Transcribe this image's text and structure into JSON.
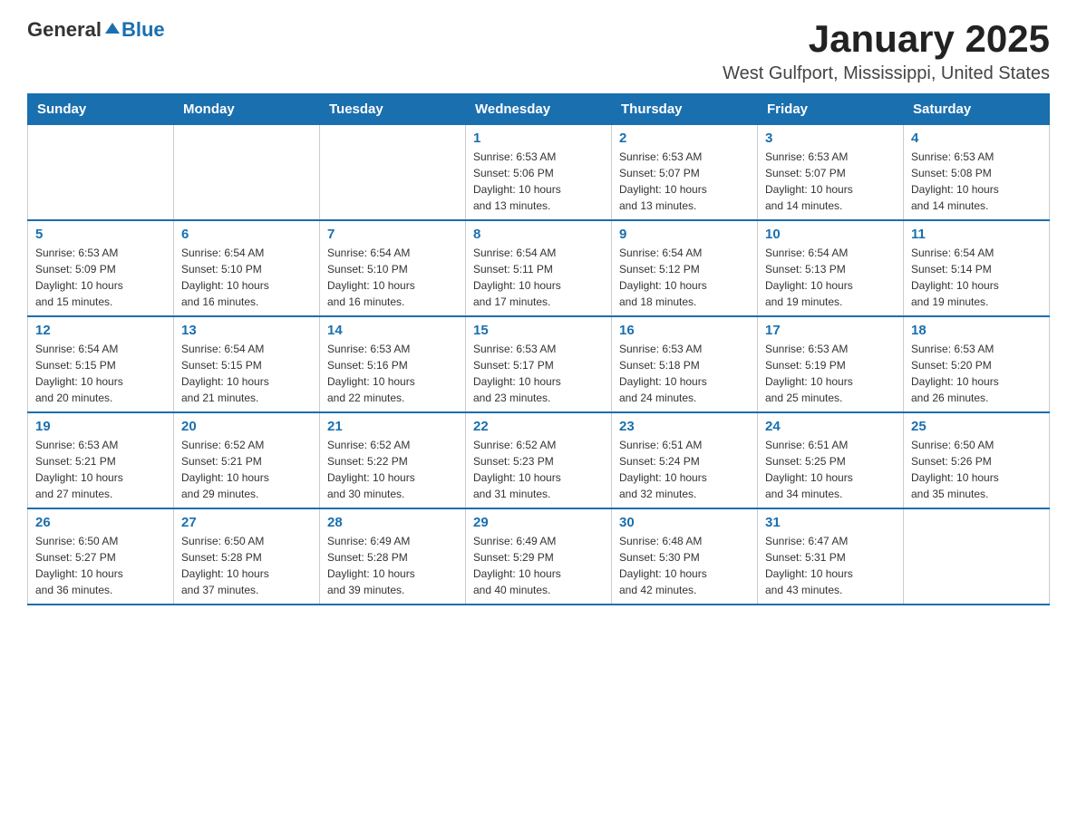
{
  "logo": {
    "general": "General",
    "blue": "Blue"
  },
  "title": "January 2025",
  "subtitle": "West Gulfport, Mississippi, United States",
  "weekdays": [
    "Sunday",
    "Monday",
    "Tuesday",
    "Wednesday",
    "Thursday",
    "Friday",
    "Saturday"
  ],
  "weeks": [
    [
      {
        "day": "",
        "info": ""
      },
      {
        "day": "",
        "info": ""
      },
      {
        "day": "",
        "info": ""
      },
      {
        "day": "1",
        "info": "Sunrise: 6:53 AM\nSunset: 5:06 PM\nDaylight: 10 hours\nand 13 minutes."
      },
      {
        "day": "2",
        "info": "Sunrise: 6:53 AM\nSunset: 5:07 PM\nDaylight: 10 hours\nand 13 minutes."
      },
      {
        "day": "3",
        "info": "Sunrise: 6:53 AM\nSunset: 5:07 PM\nDaylight: 10 hours\nand 14 minutes."
      },
      {
        "day": "4",
        "info": "Sunrise: 6:53 AM\nSunset: 5:08 PM\nDaylight: 10 hours\nand 14 minutes."
      }
    ],
    [
      {
        "day": "5",
        "info": "Sunrise: 6:53 AM\nSunset: 5:09 PM\nDaylight: 10 hours\nand 15 minutes."
      },
      {
        "day": "6",
        "info": "Sunrise: 6:54 AM\nSunset: 5:10 PM\nDaylight: 10 hours\nand 16 minutes."
      },
      {
        "day": "7",
        "info": "Sunrise: 6:54 AM\nSunset: 5:10 PM\nDaylight: 10 hours\nand 16 minutes."
      },
      {
        "day": "8",
        "info": "Sunrise: 6:54 AM\nSunset: 5:11 PM\nDaylight: 10 hours\nand 17 minutes."
      },
      {
        "day": "9",
        "info": "Sunrise: 6:54 AM\nSunset: 5:12 PM\nDaylight: 10 hours\nand 18 minutes."
      },
      {
        "day": "10",
        "info": "Sunrise: 6:54 AM\nSunset: 5:13 PM\nDaylight: 10 hours\nand 19 minutes."
      },
      {
        "day": "11",
        "info": "Sunrise: 6:54 AM\nSunset: 5:14 PM\nDaylight: 10 hours\nand 19 minutes."
      }
    ],
    [
      {
        "day": "12",
        "info": "Sunrise: 6:54 AM\nSunset: 5:15 PM\nDaylight: 10 hours\nand 20 minutes."
      },
      {
        "day": "13",
        "info": "Sunrise: 6:54 AM\nSunset: 5:15 PM\nDaylight: 10 hours\nand 21 minutes."
      },
      {
        "day": "14",
        "info": "Sunrise: 6:53 AM\nSunset: 5:16 PM\nDaylight: 10 hours\nand 22 minutes."
      },
      {
        "day": "15",
        "info": "Sunrise: 6:53 AM\nSunset: 5:17 PM\nDaylight: 10 hours\nand 23 minutes."
      },
      {
        "day": "16",
        "info": "Sunrise: 6:53 AM\nSunset: 5:18 PM\nDaylight: 10 hours\nand 24 minutes."
      },
      {
        "day": "17",
        "info": "Sunrise: 6:53 AM\nSunset: 5:19 PM\nDaylight: 10 hours\nand 25 minutes."
      },
      {
        "day": "18",
        "info": "Sunrise: 6:53 AM\nSunset: 5:20 PM\nDaylight: 10 hours\nand 26 minutes."
      }
    ],
    [
      {
        "day": "19",
        "info": "Sunrise: 6:53 AM\nSunset: 5:21 PM\nDaylight: 10 hours\nand 27 minutes."
      },
      {
        "day": "20",
        "info": "Sunrise: 6:52 AM\nSunset: 5:21 PM\nDaylight: 10 hours\nand 29 minutes."
      },
      {
        "day": "21",
        "info": "Sunrise: 6:52 AM\nSunset: 5:22 PM\nDaylight: 10 hours\nand 30 minutes."
      },
      {
        "day": "22",
        "info": "Sunrise: 6:52 AM\nSunset: 5:23 PM\nDaylight: 10 hours\nand 31 minutes."
      },
      {
        "day": "23",
        "info": "Sunrise: 6:51 AM\nSunset: 5:24 PM\nDaylight: 10 hours\nand 32 minutes."
      },
      {
        "day": "24",
        "info": "Sunrise: 6:51 AM\nSunset: 5:25 PM\nDaylight: 10 hours\nand 34 minutes."
      },
      {
        "day": "25",
        "info": "Sunrise: 6:50 AM\nSunset: 5:26 PM\nDaylight: 10 hours\nand 35 minutes."
      }
    ],
    [
      {
        "day": "26",
        "info": "Sunrise: 6:50 AM\nSunset: 5:27 PM\nDaylight: 10 hours\nand 36 minutes."
      },
      {
        "day": "27",
        "info": "Sunrise: 6:50 AM\nSunset: 5:28 PM\nDaylight: 10 hours\nand 37 minutes."
      },
      {
        "day": "28",
        "info": "Sunrise: 6:49 AM\nSunset: 5:28 PM\nDaylight: 10 hours\nand 39 minutes."
      },
      {
        "day": "29",
        "info": "Sunrise: 6:49 AM\nSunset: 5:29 PM\nDaylight: 10 hours\nand 40 minutes."
      },
      {
        "day": "30",
        "info": "Sunrise: 6:48 AM\nSunset: 5:30 PM\nDaylight: 10 hours\nand 42 minutes."
      },
      {
        "day": "31",
        "info": "Sunrise: 6:47 AM\nSunset: 5:31 PM\nDaylight: 10 hours\nand 43 minutes."
      },
      {
        "day": "",
        "info": ""
      }
    ]
  ]
}
